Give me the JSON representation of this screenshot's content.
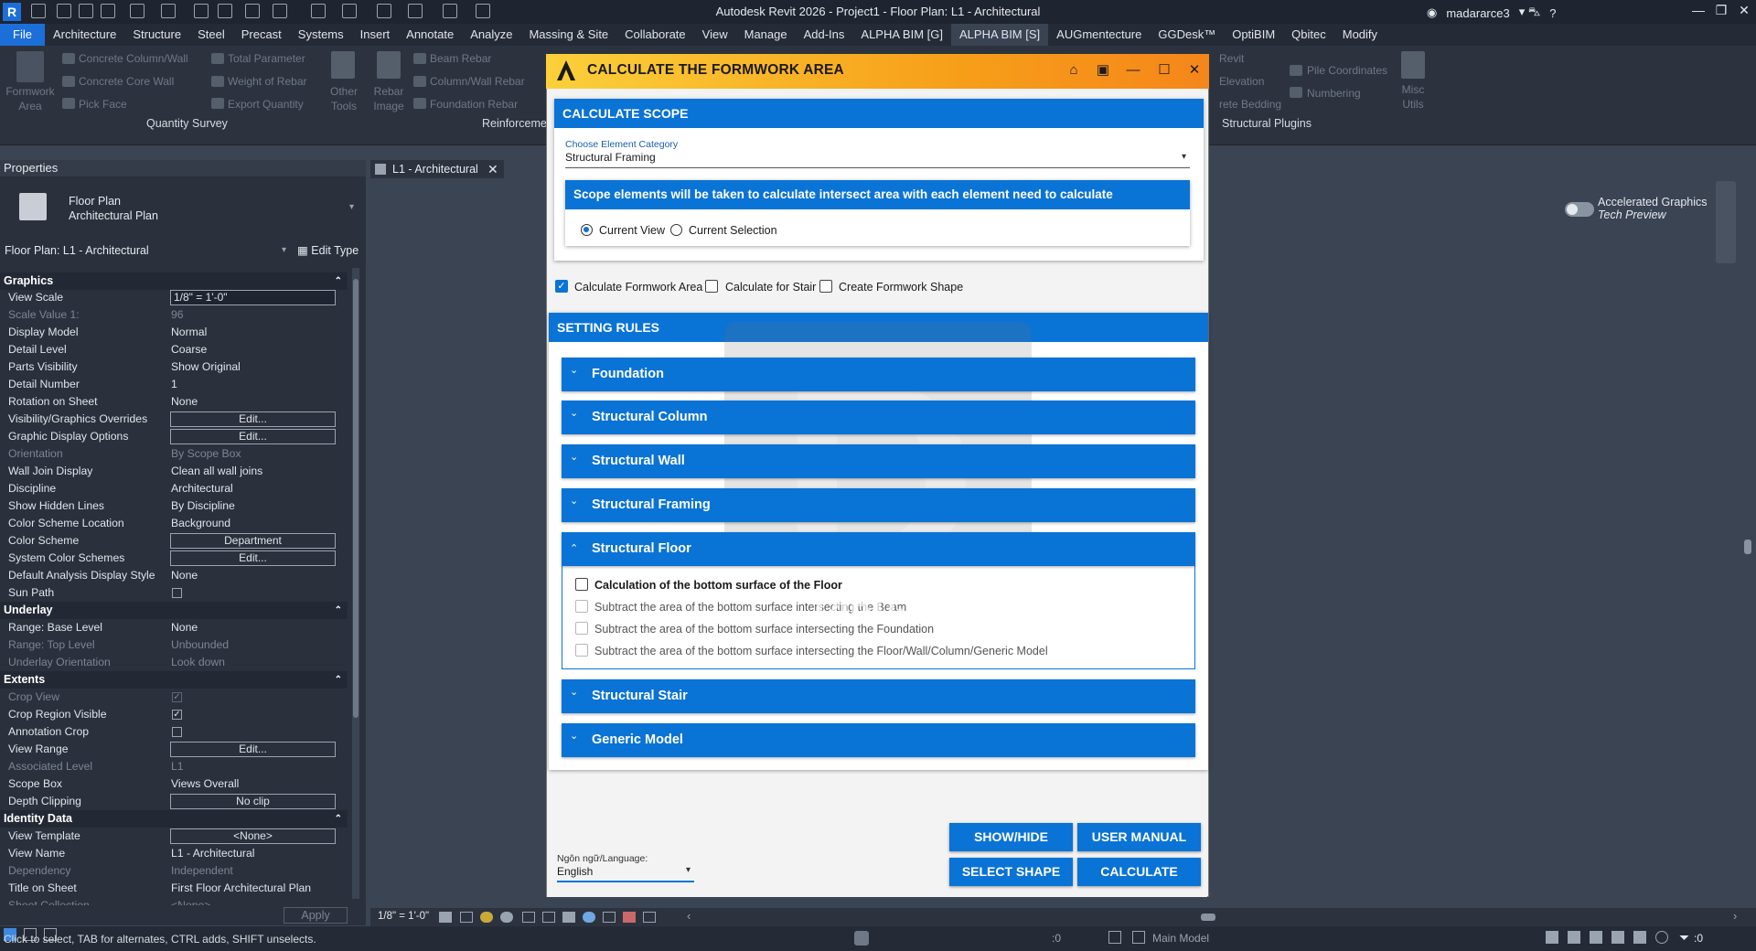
{
  "window": {
    "title": "Autodesk Revit 2026 - Project1 - Floor Plan: L1 - Architectural",
    "user": "madararce3",
    "app_icon": "R"
  },
  "menu": [
    "File",
    "Architecture",
    "Structure",
    "Steel",
    "Precast",
    "Systems",
    "Insert",
    "Annotate",
    "Analyze",
    "Massing & Site",
    "Collaborate",
    "View",
    "Manage",
    "Add-Ins",
    "ALPHA BIM [G]",
    "ALPHA BIM [S]",
    "AUGmentecture",
    "GGDesk™",
    "OptiBIM",
    "Qbitec",
    "Modify"
  ],
  "menu_active": "ALPHA BIM [S]",
  "ribbon": {
    "formwork_area": "Formwork Area",
    "concrete_column_wall": "Concrete Column/Wall",
    "concrete_core_wall": "Concrete Core Wall",
    "pick_face": "Pick Face",
    "total_parameter": "Total Parameter",
    "weight_of_rebar": "Weight of Rebar",
    "export_quantity": "Export Quantity",
    "other_tools": "Other Tools",
    "rebar_image": "Rebar Image",
    "beam_rebar": "Beam Rebar",
    "column_wall_rebar": "Column/Wall Rebar",
    "foundation_rebar": "Foundation Rebar",
    "revit": "Revit",
    "elevation": "Elevation",
    "rete_bedding": "rete Bedding",
    "pile_coordinates": "Pile Coordinates",
    "numbering": "Numbering",
    "misc_utils": "Misc Utils",
    "panel_quantity": "Quantity Survey",
    "panel_reinforcement": "Reinforceme",
    "panel_structural": "Structural Plugins"
  },
  "properties": {
    "header": "Properties",
    "type_name": "Floor Plan",
    "type_sub": "Architectural Plan",
    "instance": "Floor Plan: L1 - Architectural",
    "edit_type": "Edit Type",
    "sections": {
      "graphics": "Graphics",
      "underlay": "Underlay",
      "extents": "Extents",
      "identity": "Identity Data"
    },
    "rows": {
      "view_scale": [
        "View Scale",
        "1/8\" = 1'-0\""
      ],
      "scale_value": [
        "Scale Value    1:",
        "96"
      ],
      "display_model": [
        "Display Model",
        "Normal"
      ],
      "detail_level": [
        "Detail Level",
        "Coarse"
      ],
      "parts_visibility": [
        "Parts Visibility",
        "Show Original"
      ],
      "detail_number": [
        "Detail Number",
        "1"
      ],
      "rotation": [
        "Rotation on Sheet",
        "None"
      ],
      "vg_overrides": [
        "Visibility/Graphics Overrides",
        "Edit..."
      ],
      "graphic_display": [
        "Graphic Display Options",
        "Edit..."
      ],
      "orientation": [
        "Orientation",
        "By Scope Box"
      ],
      "wall_join": [
        "Wall Join Display",
        "Clean all wall joins"
      ],
      "discipline": [
        "Discipline",
        "Architectural"
      ],
      "hidden_lines": [
        "Show Hidden Lines",
        "By Discipline"
      ],
      "color_scheme_loc": [
        "Color Scheme Location",
        "Background"
      ],
      "color_scheme": [
        "Color Scheme",
        "Department"
      ],
      "system_color": [
        "System Color Schemes",
        "Edit..."
      ],
      "analysis_style": [
        "Default Analysis Display Style",
        "None"
      ],
      "sun_path": [
        "Sun Path",
        ""
      ],
      "base_level": [
        "Range: Base Level",
        "None"
      ],
      "top_level": [
        "Range: Top Level",
        "Unbounded"
      ],
      "underlay_orient": [
        "Underlay Orientation",
        "Look down"
      ],
      "crop_view": [
        "Crop View",
        "✓"
      ],
      "crop_region": [
        "Crop Region Visible",
        "✓"
      ],
      "annotation_crop": [
        "Annotation Crop",
        ""
      ],
      "view_range": [
        "View Range",
        "Edit..."
      ],
      "assoc_level": [
        "Associated Level",
        "L1"
      ],
      "scope_box": [
        "Scope Box",
        "Views Overall"
      ],
      "depth_clipping": [
        "Depth Clipping",
        "No clip"
      ],
      "view_template": [
        "View Template",
        "<None>"
      ],
      "view_name": [
        "View Name",
        "L1 - Architectural"
      ],
      "dependency": [
        "Dependency",
        "Independent"
      ],
      "title_on_sheet": [
        "Title on Sheet",
        "First Floor Architectural Plan"
      ],
      "sheet_collection": [
        "Sheet Collection",
        "<None>"
      ]
    },
    "apply": "Apply"
  },
  "view_tab": "L1 - Architectural",
  "view_scale_bar": "1/8\" = 1'-0\"",
  "accelerated": [
    "Accelerated Graphics",
    "Tech Preview"
  ],
  "status": {
    "hint": "Click to select, TAB for alternates, CTRL adds, SHIFT unselects.",
    "model": "Main Model",
    "count_a": ":0",
    "count_b": ":0"
  },
  "dialog": {
    "title": "CALCULATE THE FORMWORK AREA",
    "scope_title": "CALCULATE SCOPE",
    "category_label": "Choose Element Category",
    "category_value": "Structural Framing",
    "scope_note": "Scope elements will be taken to calculate intersect area with each element need to calculate",
    "radio_current_view": "Current View",
    "radio_current_selection": "Current Selection",
    "chk_formwork_area": "Calculate Formwork Area",
    "chk_stair": "Calculate for Stair",
    "chk_shape": "Create Formwork Shape",
    "rules_title": "SETTING RULES",
    "acc_foundation": "Foundation",
    "acc_column": "Structural Column",
    "acc_wall": "Structural Wall",
    "acc_framing": "Structural Framing",
    "acc_floor": "Structural Floor",
    "floor_opt1": "Calculation of the bottom surface of the Floor",
    "floor_opt2": "Subtract the area of the bottom surface intersecting the Beam",
    "floor_opt3": "Subtract the area of the bottom surface intersecting the Foundation",
    "floor_opt4": "Subtract the area of the bottom surface intersecting the Floor/Wall/Column/Generic Model",
    "acc_stair": "Structural Stair",
    "acc_generic": "Generic Model",
    "lang_label": "Ngôn ngữ/Language:",
    "lang_value": "English",
    "btn_show_hide": "SHOW/HIDE",
    "btn_manual": "USER MANUAL",
    "btn_select_shape": "SELECT SHAPE",
    "btn_calculate": "CALCULATE",
    "watermark_letter": "D",
    "watermark_text": "DiRoSoft"
  },
  "colors": {
    "accent_blue": "#0a73d6",
    "header_orange": "#f7a019",
    "revit_dark": "#2a313d"
  }
}
